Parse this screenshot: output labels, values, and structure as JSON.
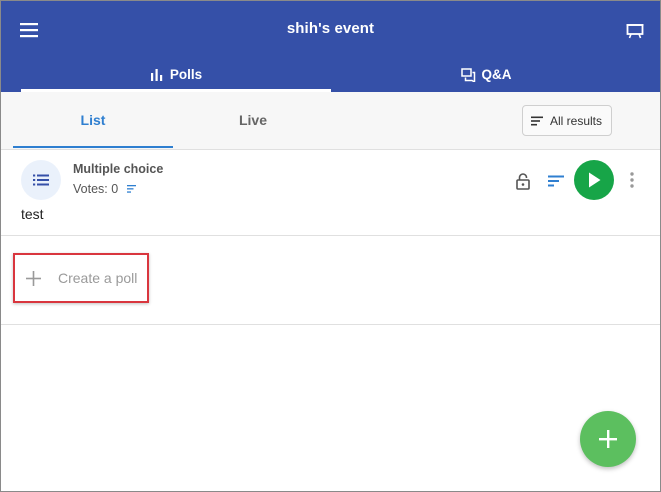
{
  "header": {
    "event_title": "shih's event",
    "menu_icon": "hamburger-menu-icon",
    "present_icon": "presentation-screen-icon"
  },
  "top_tabs": [
    {
      "label": "Polls",
      "icon": "bar-chart-icon",
      "active": true
    },
    {
      "label": "Q&A",
      "icon": "chat-bubbles-icon",
      "active": false
    }
  ],
  "sub_tabs": [
    {
      "label": "List",
      "active": true
    },
    {
      "label": "Live",
      "active": false
    }
  ],
  "results_button": {
    "label": "All results",
    "icon": "sort-lines-icon"
  },
  "poll": {
    "type": "Multiple choice",
    "votes_label": "Votes: 0",
    "question": "test",
    "icon": "list-icon"
  },
  "create_poll": {
    "label": "Create a poll",
    "icon": "plus-icon"
  },
  "fab": {
    "icon": "plus-icon"
  },
  "colors": {
    "header_bg": "#3550a8",
    "accent_blue": "#2f7fd0",
    "play_green": "#17a548",
    "fab_green": "#5cbf5f",
    "highlight_red": "#d9363e"
  }
}
